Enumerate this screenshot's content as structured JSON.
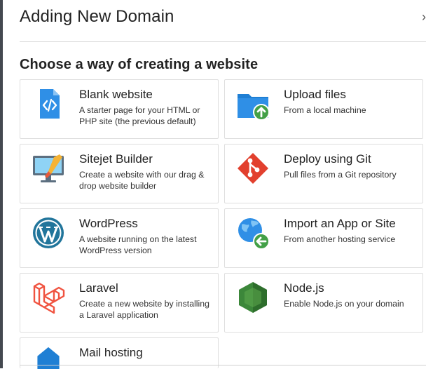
{
  "header": {
    "title": "Adding New Domain",
    "close_glyph": "›"
  },
  "section": {
    "title": "Choose a way of creating a website"
  },
  "options": [
    {
      "title": "Blank website",
      "desc": "A starter page for your HTML or PHP site (the previous default)",
      "icon": "code-file-icon"
    },
    {
      "title": "Upload files",
      "desc": "From a local machine",
      "icon": "folder-upload-icon"
    },
    {
      "title": "Sitejet Builder",
      "desc": "Create a website with our drag & drop website builder",
      "icon": "monitor-brush-icon"
    },
    {
      "title": "Deploy using Git",
      "desc": "Pull files from a Git repository",
      "icon": "git-icon"
    },
    {
      "title": "WordPress",
      "desc": "A website running on the latest WordPress version",
      "icon": "wordpress-icon"
    },
    {
      "title": "Import an App or Site",
      "desc": "From another hosting service",
      "icon": "globe-import-icon"
    },
    {
      "title": "Laravel",
      "desc": "Create a new website by installing a Laravel application",
      "icon": "laravel-icon"
    },
    {
      "title": "Node.js",
      "desc": "Enable Node.js on your domain",
      "icon": "nodejs-icon"
    },
    {
      "title": "Mail hosting",
      "desc": "",
      "icon": "mail-icon"
    }
  ],
  "colors": {
    "blue": "#2f8fe6",
    "green": "#43a047",
    "git_red": "#e2402e",
    "laravel_red": "#f05340",
    "wordpress_blue": "#21759b",
    "node_green": "#3c873a"
  }
}
